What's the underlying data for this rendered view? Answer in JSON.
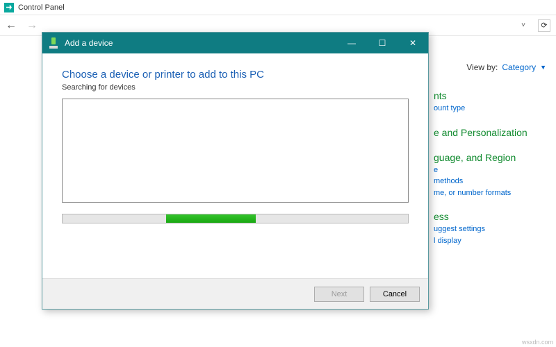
{
  "bg": {
    "title": "Control Panel",
    "viewby_label": "View by:",
    "viewby_value": "Category"
  },
  "categories": {
    "g1": {
      "title": "nts",
      "link1": "ount type"
    },
    "g2": {
      "title": "e and Personalization"
    },
    "g3": {
      "title": "guage, and Region",
      "link1": "e",
      "link2": "methods",
      "link3": "me, or number formats"
    },
    "g4": {
      "title": "ess",
      "link1": "uggest settings",
      "link2": "l display"
    }
  },
  "dialog": {
    "title": "Add a device",
    "heading": "Choose a device or printer to add to this PC",
    "subheading": "Searching for devices",
    "next": "Next",
    "cancel": "Cancel"
  },
  "watermark": "wsxdn.com"
}
